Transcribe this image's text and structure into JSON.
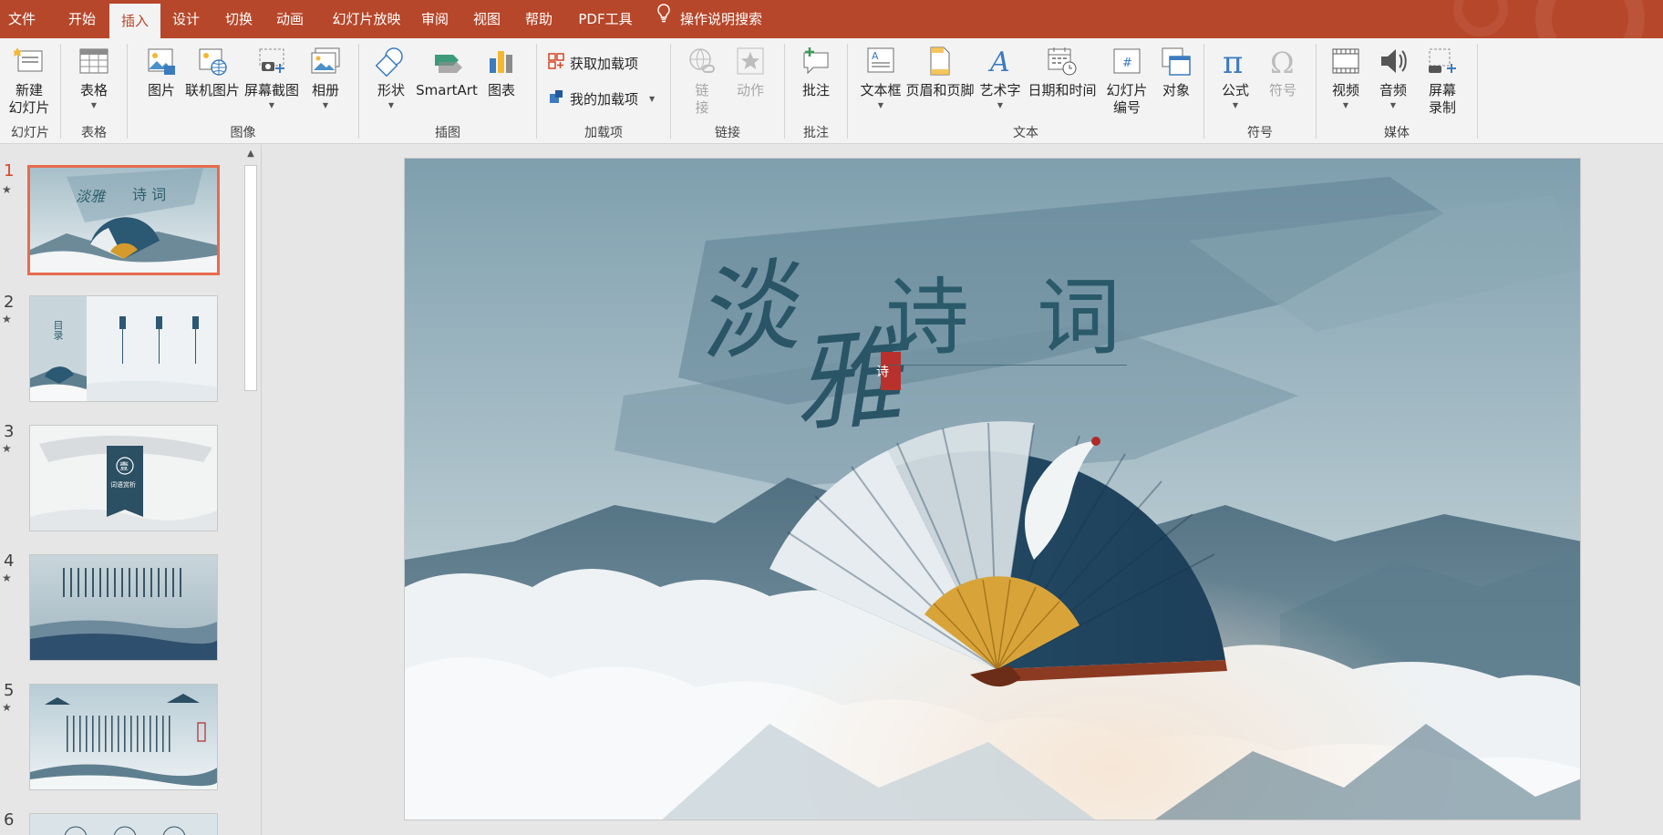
{
  "menu": {
    "tabs": [
      "文件",
      "开始",
      "插入",
      "设计",
      "切换",
      "动画",
      "幻灯片放映",
      "审阅",
      "视图",
      "帮助",
      "PDF工具"
    ],
    "active_tab": "插入",
    "tell_me": "操作说明搜索"
  },
  "ribbon": {
    "groups": {
      "slides": "幻灯片",
      "tables": "表格",
      "images": "图像",
      "illustrations": "插图",
      "addins": "加载项",
      "links": "链接",
      "comments": "批注",
      "text": "文本",
      "symbols": "符号",
      "media": "媒体"
    },
    "buttons": {
      "new_slide_1": "新建",
      "new_slide_2": "幻灯片",
      "table": "表格",
      "picture": "图片",
      "online_picture": "联机图片",
      "screenshot": "屏幕截图",
      "album": "相册",
      "shapes": "形状",
      "smartart": "SmartArt",
      "chart": "图表",
      "get_addins": "获取加载项",
      "my_addins": "我的加载项",
      "link_1": "链",
      "link_2": "接",
      "action": "动作",
      "comment": "批注",
      "textbox": "文本框",
      "header_footer": "页眉和页脚",
      "wordart": "艺术字",
      "date_time": "日期和时间",
      "slide_number_1": "幻灯片",
      "slide_number_2": "编号",
      "object": "对象",
      "equation": "公式",
      "symbol": "符号",
      "video": "视频",
      "audio": "音频",
      "screen_record_1": "屏幕",
      "screen_record_2": "录制"
    }
  },
  "thumbnails": [
    {
      "num": "1",
      "star": "★"
    },
    {
      "num": "2",
      "star": "★"
    },
    {
      "num": "3",
      "star": "★"
    },
    {
      "num": "4",
      "star": "★"
    },
    {
      "num": "5",
      "star": "★"
    },
    {
      "num": "6",
      "star": ""
    }
  ],
  "thumb_text": {
    "t1_title_a": "淡雅",
    "t1_title_b": "诗 词",
    "t2_title": "目录",
    "t3_label": "词语赏析",
    "t3_glyph": "壹"
  },
  "slide": {
    "title_calligraphy_1": "淡",
    "title_calligraphy_2": "雅",
    "title_main_1": "诗",
    "title_main_2": "词",
    "seal": "诗"
  },
  "colors": {
    "accent": "#b7472a",
    "active_thumb_border": "#e76b4d",
    "slide_bg": "#8aa9b6",
    "ink": "#2f5f6c"
  }
}
